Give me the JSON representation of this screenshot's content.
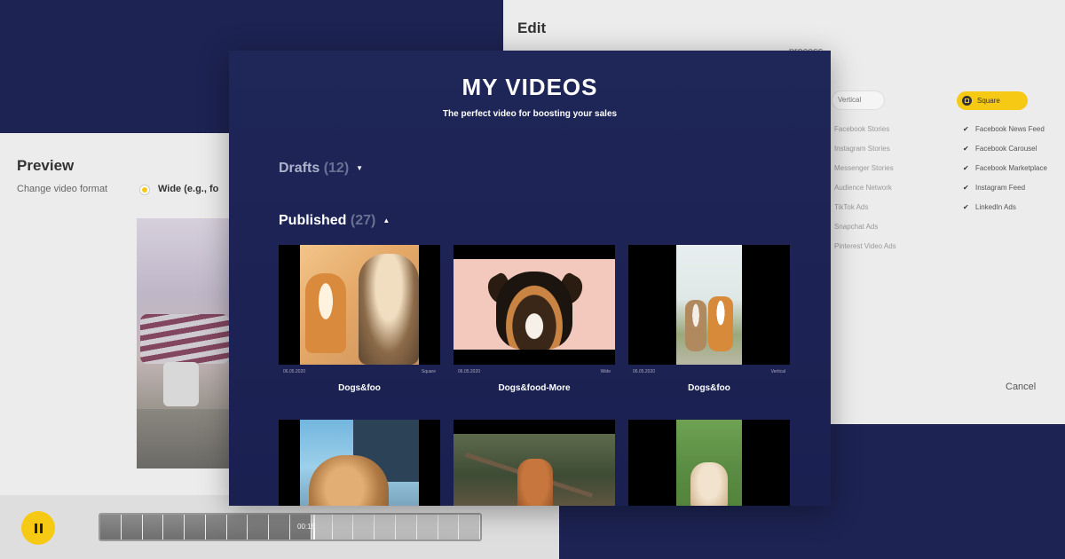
{
  "edit": {
    "title": "Edit",
    "subtitle": "process",
    "format_vertical": "Vertical",
    "format_square": "Square",
    "vertical_placements": [
      "Facebook Stories",
      "Instagram Stories",
      "Messenger Stories",
      "Audience Network",
      "TikTok Ads",
      "Snapchat Ads",
      "Pinterest Video Ads"
    ],
    "square_placements": [
      "Facebook News Feed",
      "Facebook Carousel",
      "Facebook Marketplace",
      "Instagram Feed",
      "LinkedIn Ads"
    ],
    "cancel_label": "Cancel"
  },
  "preview": {
    "title": "Preview",
    "format_label": "Change video format",
    "wide_option": "Wide (e.g., fo",
    "timecode": "00:15"
  },
  "modal": {
    "title": "MY VIDEOS",
    "subtitle": "The perfect video for boosting your sales",
    "drafts": {
      "label": "Drafts",
      "count": "(12)"
    },
    "published": {
      "label": "Published",
      "count": "(27)"
    },
    "videos": [
      {
        "date": "06.05.2020",
        "format": "Square",
        "name": "Dogs&foo"
      },
      {
        "date": "06.05.2020",
        "format": "Wide",
        "name": "Dogs&food-More"
      },
      {
        "date": "06.05.2020",
        "format": "Vertical",
        "name": "Dogs&foo"
      }
    ]
  },
  "colors": {
    "navy": "#1d2352",
    "accent_yellow": "#f6c915",
    "panel_grey": "#ececec"
  }
}
